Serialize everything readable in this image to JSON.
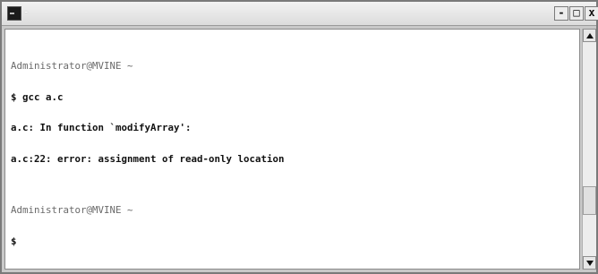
{
  "window": {
    "title": "-",
    "controls": {
      "minimize": "-",
      "maximize": "□",
      "close": "x"
    }
  },
  "terminal": {
    "lines": [
      "Administrator@MVINE ~",
      "$ gcc a.c",
      "a.c: In function `modifyArray':",
      "a.c:22: error: assignment of read-only location",
      "",
      "Administrator@MVINE ~",
      "$"
    ]
  },
  "icons": {
    "app": "terminal-app-icon",
    "scroll_up": "scroll-up-arrow-icon",
    "scroll_down": "scroll-down-arrow-icon"
  },
  "colors": {
    "terminal_bg": "#ffffff",
    "text": "#111111",
    "prompt_text": "#6a6a6a",
    "titlebar": "#e6e6e6"
  }
}
